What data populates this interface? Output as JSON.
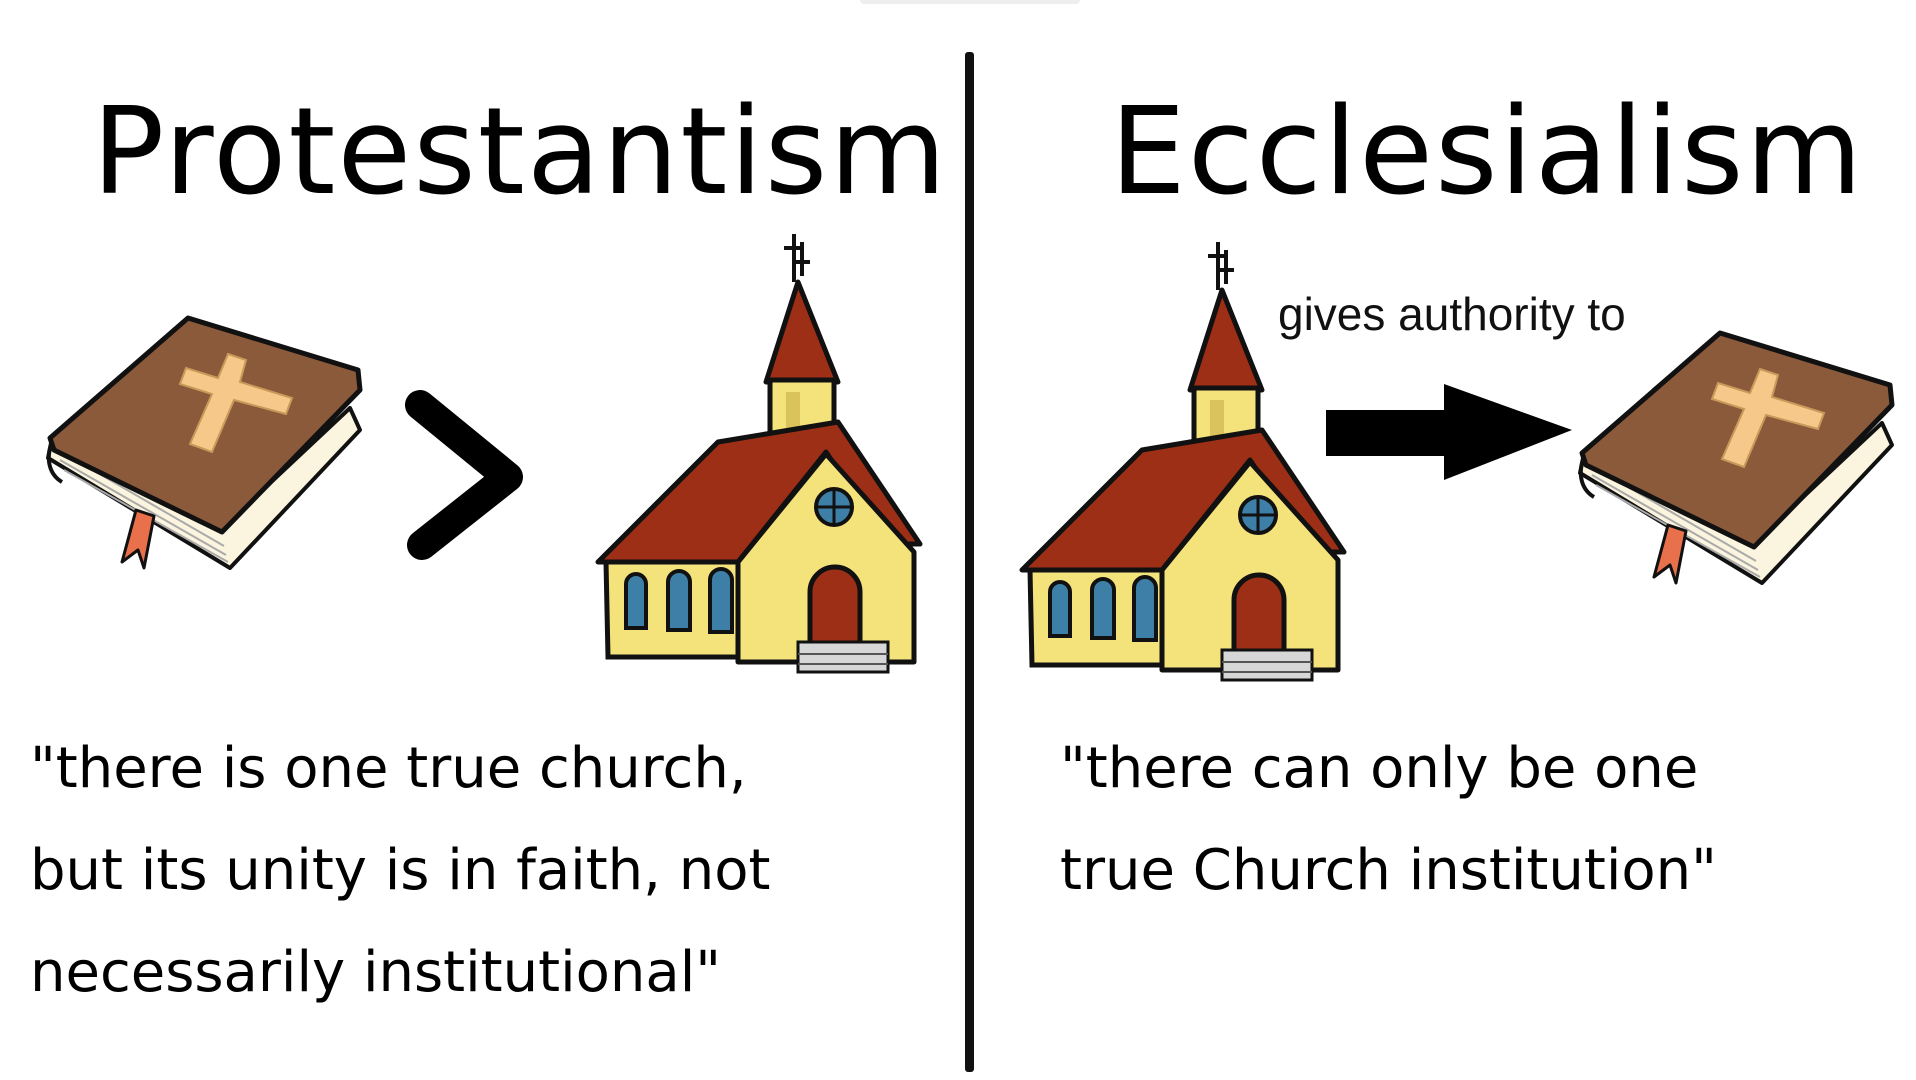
{
  "left_panel": {
    "title": "Protestantism",
    "relation_symbol": ">",
    "quote_lines": [
      "\"there is one true church,",
      "but its unity is in faith, not",
      "necessarily institutional\""
    ]
  },
  "right_panel": {
    "title": "Ecclesialism",
    "arrow_label": "gives authority to",
    "quote_lines": [
      "\"there can only be one",
      "true Church institution\""
    ]
  },
  "icons": {
    "bible": "bible-icon",
    "church": "church-icon",
    "arrow": "right-arrow-icon"
  },
  "colors": {
    "book_cover": "#8a5a3b",
    "cross": "#f6c98a",
    "roof": "#9c2f16",
    "walls": "#f4e27a",
    "bookmark": "#e8704a"
  }
}
